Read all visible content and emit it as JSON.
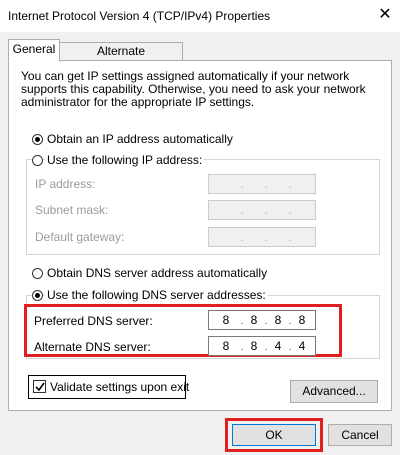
{
  "window": {
    "title": "Internet Protocol Version 4 (TCP/IPv4) Properties",
    "close_glyph": "✕"
  },
  "tabs": [
    {
      "label": "General",
      "selected": true
    },
    {
      "label": "Alternate Configuration",
      "selected": false
    }
  ],
  "description": "You can get IP settings assigned automatically if your network supports this capability. Otherwise, you need to ask your network administrator for the appropriate IP settings.",
  "ip": {
    "auto_label": "Obtain an IP address automatically",
    "manual_label": "Use the following IP address:",
    "fields": [
      {
        "label": "IP address:"
      },
      {
        "label": "Subnet mask:"
      },
      {
        "label": "Default gateway:"
      }
    ]
  },
  "dns": {
    "auto_label": "Obtain DNS server address automatically",
    "manual_label": "Use the following DNS server addresses:",
    "preferred_label": "Preferred DNS server:",
    "preferred_octets": [
      "8",
      "8",
      "8",
      "8"
    ],
    "alternate_label": "Alternate DNS server:",
    "alternate_octets": [
      "8",
      "8",
      "4",
      "4"
    ]
  },
  "validate_label": "Validate settings upon exit",
  "advanced_label": "Advanced...",
  "ok_label": "OK",
  "cancel_label": "Cancel",
  "dot": ".",
  "colors": {
    "highlight": "#e02020",
    "focus_border": "#0078d7"
  }
}
